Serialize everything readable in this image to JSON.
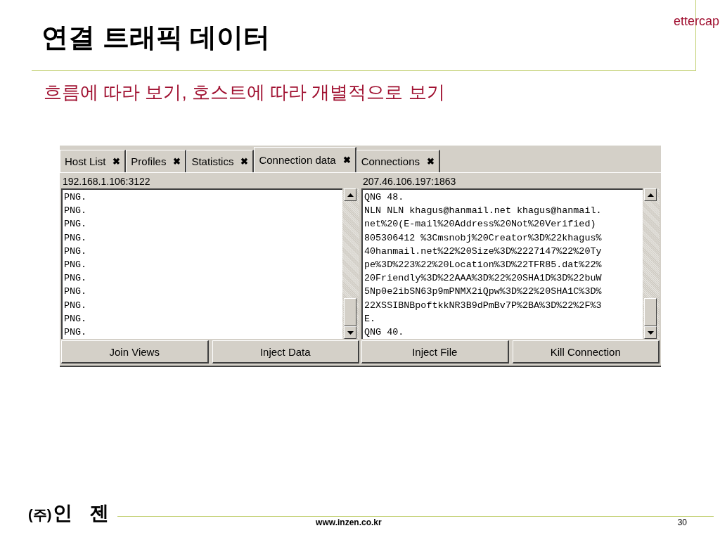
{
  "slide": {
    "title": "연결 트래픽 데이터",
    "tag": "ettercap",
    "subtitle": "흐름에 따라 보기, 호스트에 따라 개별적으로 보기"
  },
  "app": {
    "tabs": [
      {
        "label": "Host List",
        "close": "✖",
        "selected": false
      },
      {
        "label": "Profiles",
        "close": "✖",
        "selected": false
      },
      {
        "label": "Statistics",
        "close": "✖",
        "selected": false
      },
      {
        "label": "Connection data",
        "close": "✖",
        "selected": true
      },
      {
        "label": "Connections",
        "close": "✖",
        "selected": false
      }
    ],
    "panes": [
      {
        "address": "192.168.1.106:3122",
        "lines": [
          "PNG.",
          "PNG.",
          "PNG.",
          "PNG.",
          "PNG.",
          "PNG.",
          "PNG.",
          "PNG.",
          "PNG.",
          "PNG.",
          "PNG."
        ],
        "buttons": [
          "Join Views",
          "Inject Data"
        ]
      },
      {
        "address": "207.46.106.197:1863",
        "lines": [
          "QNG 48.",
          "NLN NLN khagus@hanmail.net khagus@hanmail.",
          "net%20(E-mail%20Address%20Not%20Verified)",
          "805306412 %3Cmsnobj%20Creator%3D%22khagus%",
          "40hanmail.net%22%20Size%3D%2227147%22%20Ty",
          "pe%3D%223%22%20Location%3D%22TFR85.dat%22%",
          "20Friendly%3D%22AAA%3D%22%20SHA1D%3D%22buW",
          "5Np0e2ibSN63p9mPNMX2iQpw%3D%22%20SHA1C%3D%",
          "22XSSIBNBpoftkkNR3B9dPmBv7P%2BA%3D%22%2F%3",
          "E.",
          "QNG 40."
        ],
        "buttons": [
          "Inject File",
          "Kill Connection"
        ]
      }
    ]
  },
  "footer": {
    "logo_left": "(주)",
    "logo_right": "인 젠",
    "url": "www.inzen.co.kr",
    "page": "30"
  }
}
